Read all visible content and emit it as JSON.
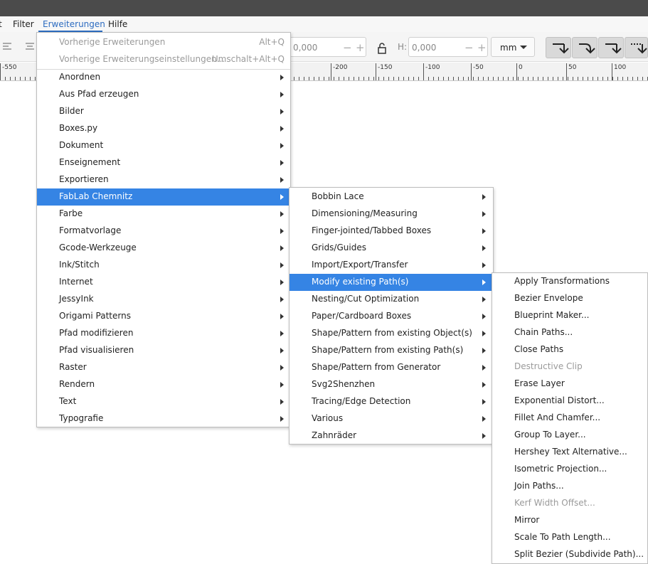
{
  "menubar": {
    "items": [
      {
        "label": "t"
      },
      {
        "label": "Filter"
      },
      {
        "label": "Erweiterungen"
      },
      {
        "label": "Hilfe"
      }
    ]
  },
  "toolbar": {
    "w_value": "0,000",
    "h_label": "H:",
    "h_value": "0,000",
    "unit": "mm"
  },
  "ruler": {
    "labels": [
      "-550",
      "-200",
      "-150",
      "-100",
      "-50",
      "0",
      "50",
      "100"
    ]
  },
  "menu_main": {
    "top_items": [
      {
        "label": "Vorherige Erweiterungen",
        "accel": "Alt+Q",
        "disabled": true
      },
      {
        "label": "Vorherige Erweiterungseinstellungen...",
        "accel": "Umschalt+Alt+Q",
        "disabled": true
      }
    ],
    "items": [
      {
        "label": "Anordnen"
      },
      {
        "label": "Aus Pfad erzeugen"
      },
      {
        "label": "Bilder"
      },
      {
        "label": "Boxes.py"
      },
      {
        "label": "Dokument"
      },
      {
        "label": "Enseignement"
      },
      {
        "label": "Exportieren"
      },
      {
        "label": "FabLab Chemnitz",
        "highlighted": true
      },
      {
        "label": "Farbe"
      },
      {
        "label": "Formatvorlage"
      },
      {
        "label": "Gcode-Werkzeuge"
      },
      {
        "label": "Ink/Stitch"
      },
      {
        "label": "Internet"
      },
      {
        "label": "JessyInk"
      },
      {
        "label": "Origami Patterns"
      },
      {
        "label": "Pfad modifizieren"
      },
      {
        "label": "Pfad visualisieren"
      },
      {
        "label": "Raster"
      },
      {
        "label": "Rendern"
      },
      {
        "label": "Text"
      },
      {
        "label": "Typografie"
      }
    ]
  },
  "menu_fablab": {
    "items": [
      {
        "label": "Bobbin Lace"
      },
      {
        "label": "Dimensioning/Measuring"
      },
      {
        "label": "Finger-jointed/Tabbed Boxes"
      },
      {
        "label": "Grids/Guides"
      },
      {
        "label": "Import/Export/Transfer"
      },
      {
        "label": "Modify existing Path(s)",
        "highlighted": true
      },
      {
        "label": "Nesting/Cut Optimization"
      },
      {
        "label": "Paper/Cardboard Boxes"
      },
      {
        "label": "Shape/Pattern from existing Object(s)"
      },
      {
        "label": "Shape/Pattern from existing Path(s)"
      },
      {
        "label": "Shape/Pattern from Generator"
      },
      {
        "label": "Svg2Shenzhen"
      },
      {
        "label": "Tracing/Edge Detection"
      },
      {
        "label": "Various"
      },
      {
        "label": "Zahnräder"
      }
    ]
  },
  "menu_modify": {
    "items": [
      {
        "label": "Apply Transformations"
      },
      {
        "label": "Bezier Envelope"
      },
      {
        "label": "Blueprint Maker..."
      },
      {
        "label": "Chain Paths..."
      },
      {
        "label": "Close Paths"
      },
      {
        "label": "Destructive Clip",
        "disabled": true
      },
      {
        "label": "Erase Layer"
      },
      {
        "label": "Exponential Distort..."
      },
      {
        "label": "Fillet And Chamfer..."
      },
      {
        "label": "Group To Layer..."
      },
      {
        "label": "Hershey Text Alternative..."
      },
      {
        "label": "Isometric Projection..."
      },
      {
        "label": "Join Paths..."
      },
      {
        "label": "Kerf Width Offset...",
        "disabled": true
      },
      {
        "label": "Mirror"
      },
      {
        "label": "Scale To Path Length..."
      },
      {
        "label": "Split Bezier (Subdivide Path)..."
      }
    ]
  },
  "colors": {
    "highlight": "#3584e4",
    "menubar_active": "#2d6cc0",
    "titlebar": "#4b4b4b"
  }
}
